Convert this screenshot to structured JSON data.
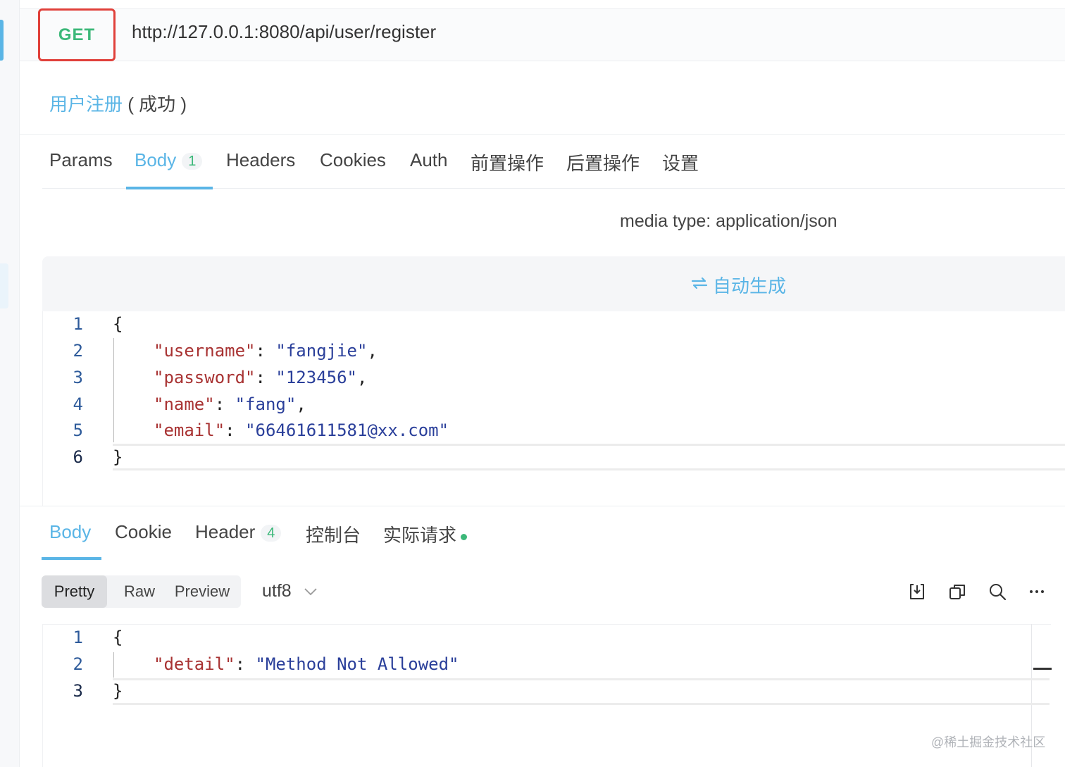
{
  "request": {
    "method": "GET",
    "url": "http://127.0.0.1:8080/api/user/register",
    "name": "用户注册",
    "status": "( 成功 )"
  },
  "tabs": [
    {
      "label": "Params"
    },
    {
      "label": "Body",
      "badge": "1"
    },
    {
      "label": "Headers"
    },
    {
      "label": "Cookies"
    },
    {
      "label": "Auth"
    },
    {
      "label": "前置操作"
    },
    {
      "label": "后置操作"
    },
    {
      "label": "设置"
    }
  ],
  "body": {
    "media_type": "media type: application/json",
    "autogen_label": "自动生成",
    "lines": [
      {
        "num": "1",
        "open": "{"
      },
      {
        "num": "2",
        "key": "\"username\"",
        "sep": ": ",
        "val": "\"fangjie\"",
        "end": ","
      },
      {
        "num": "3",
        "key": "\"password\"",
        "sep": ": ",
        "val": "\"123456\"",
        "end": ","
      },
      {
        "num": "4",
        "key": "\"name\"",
        "sep": ": ",
        "val": "\"fang\"",
        "end": ","
      },
      {
        "num": "5",
        "key": "\"email\"",
        "sep": ": ",
        "val": "\"66461611581@xx.com\"",
        "end": ""
      },
      {
        "num": "6",
        "close": "}"
      }
    ]
  },
  "response": {
    "tabs": [
      {
        "label": "Body"
      },
      {
        "label": "Cookie"
      },
      {
        "label": "Header",
        "badge": "4"
      },
      {
        "label": "控制台"
      },
      {
        "label": "实际请求"
      }
    ],
    "view_modes": [
      "Pretty",
      "Raw",
      "Preview"
    ],
    "encoding": "utf8",
    "lines": [
      {
        "num": "1",
        "open": "{"
      },
      {
        "num": "2",
        "key": "\"detail\"",
        "sep": ": ",
        "val": "\"Method Not Allowed\"",
        "end": ""
      },
      {
        "num": "3",
        "close": "}"
      }
    ]
  },
  "icons": {
    "download": "download-icon",
    "copy": "copy-icon",
    "search": "search-icon",
    "more": "more-icon",
    "autogen": "swap-icon"
  },
  "colors": {
    "accent": "#5ab5e6",
    "method": "#3cb879",
    "highlight_border": "#e0403a"
  },
  "watermark": "@稀土掘金技术社区"
}
